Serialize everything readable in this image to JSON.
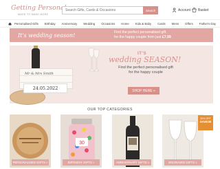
{
  "brand": {
    "name": "Getting Personal",
    "tagline": "MADE TO MAKE MORE"
  },
  "search": {
    "placeholder": "Search Gifts, Cards & Occasions",
    "button": "Search"
  },
  "header": {
    "account": "Account",
    "basket": "Basket"
  },
  "nav": {
    "items": [
      "Personalised Gifts",
      "Birthday",
      "Anniversary",
      "Wedding",
      "Occasions",
      "Home",
      "Kids & Baby",
      "Cards",
      "Mens",
      "Offers",
      "Father's Day"
    ]
  },
  "promo": {
    "title": "It's wedding season!",
    "line1": "Find the perfect personalised gift",
    "line2": "for the happy couple",
    "price_prefix": "from just",
    "price": "£7.99"
  },
  "hero": {
    "its": "IT'S",
    "title": "wedding SEASON!",
    "sub1": "Find the perfect personalised gift",
    "sub2": "for the happy couple",
    "button": "SHOP HERE »",
    "crate_text": "Mr & Mrs Smith",
    "date": "24.05.2022"
  },
  "categories": {
    "title": "OUR TOP CATEGORIES",
    "items": [
      "PERSONALISED GIFTS »",
      "BIRTHDAY GIFTS »",
      "ANNIVERSARY GIFTS »",
      "ENGRAVED GIFTS »"
    ]
  },
  "sale_badge": {
    "l1": "30% OFF",
    "l2": "SAVE30",
    "color": "#e48f34"
  },
  "colors": {
    "accent": "#d98f8a",
    "promo_bg": "#e2a7a2",
    "hero_bg": "#f4e6e3"
  }
}
